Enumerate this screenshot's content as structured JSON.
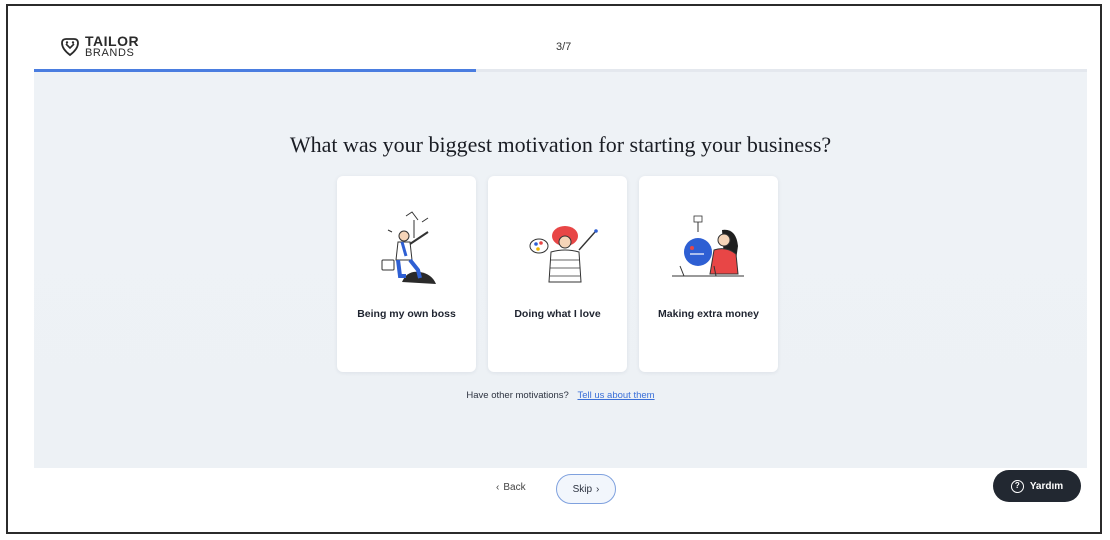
{
  "header": {
    "logo_line1": "TAILOR",
    "logo_line2": "BRANDS",
    "step": "3/7",
    "progress": 0.42
  },
  "main": {
    "question": "What was your biggest motivation for starting your business?",
    "options": [
      {
        "label": "Being my own boss",
        "icon": "businessman-flag-icon"
      },
      {
        "label": "Doing what I love",
        "icon": "artist-palette-icon"
      },
      {
        "label": "Making extra money",
        "icon": "woman-piggybank-icon"
      }
    ],
    "other_text": "Have other motivations?",
    "other_link": "Tell us about them"
  },
  "footer": {
    "back_label": "Back",
    "skip_label": "Skip",
    "help_label": "Yardım"
  },
  "colors": {
    "accent": "#4a7de0",
    "help_bg": "#222831",
    "background": "#eef2f6"
  }
}
